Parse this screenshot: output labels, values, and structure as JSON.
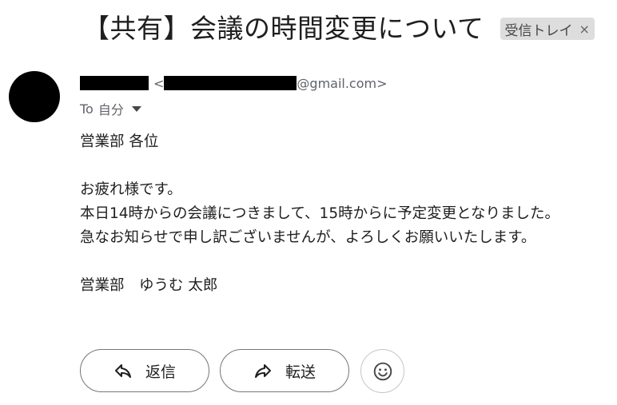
{
  "email": {
    "subject": "【共有】会議の時間変更について",
    "label": "受信トレイ",
    "label_close": "×",
    "from_open": "<",
    "from_email_suffix": "@gmail.com>",
    "to_prefix": "To",
    "to_name": "自分",
    "body_lines": [
      "営業部 各位",
      "",
      "お疲れ様です。",
      "本日14時からの会議につきまして、15時からに予定変更となりました。",
      "急なお知らせで申し訳ございませんが、よろしくお願いいたします。",
      "",
      "営業部　ゆうむ 太郎"
    ]
  },
  "actions": {
    "reply_label": "返信",
    "forward_label": "転送"
  },
  "icons": {
    "reply": "reply-arrow-icon",
    "forward": "forward-arrow-icon",
    "emoji": "smiley-icon",
    "to_dropdown": "caret-down-icon"
  },
  "colors": {
    "label_chip_bg": "#dddddd",
    "text": "#1f1f1f",
    "muted": "#5f6368"
  }
}
